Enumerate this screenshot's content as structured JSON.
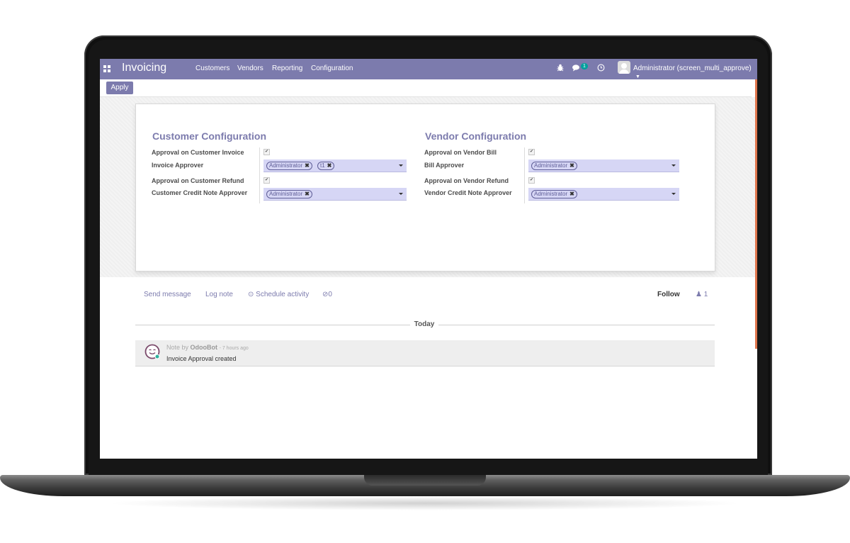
{
  "navbar": {
    "brand": "Invoicing",
    "menus": [
      "Customers",
      "Vendors",
      "Reporting",
      "Configuration"
    ],
    "messages_count": "1",
    "user": "Administrator (screen_multi_approve)",
    "icons": [
      "apps-icon",
      "bug-icon",
      "chat-icon",
      "clock-icon",
      "user-avatar",
      "caret-down-icon"
    ]
  },
  "control_panel": {
    "apply_label": "Apply"
  },
  "customer": {
    "title": "Customer Configuration",
    "approval_invoice_label": "Approval on Customer Invoice",
    "approval_invoice_checked": true,
    "invoice_approver_label": "Invoice Approver",
    "invoice_approvers": [
      "Administrator",
      "t1"
    ],
    "approval_refund_label": "Approval on Customer Refund",
    "approval_refund_checked": true,
    "credit_note_approver_label": "Customer Credit Note Approver",
    "credit_note_approvers": [
      "Administrator"
    ]
  },
  "vendor": {
    "title": "Vendor Configuration",
    "approval_bill_label": "Approval on Vendor Bill",
    "approval_bill_checked": true,
    "bill_approver_label": "Bill Approver",
    "bill_approvers": [
      "Administrator"
    ],
    "approval_refund_label": "Approval on Vendor Refund",
    "approval_refund_checked": true,
    "credit_note_approver_label": "Vendor Credit Note Approver",
    "credit_note_approvers": [
      "Administrator"
    ]
  },
  "chatter": {
    "send_message": "Send message",
    "log_note": "Log note",
    "schedule_activity": "Schedule activity",
    "attachments": "0",
    "follow": "Follow",
    "followers": "1",
    "date_separator": "Today",
    "message": {
      "prefix": "Note by",
      "author": "OdooBot",
      "time": "- 7 hours ago",
      "body": "Invoice Approval created"
    }
  },
  "colors": {
    "brand": "#7c7bad",
    "badge": "#00a09d",
    "field_bg": "#d6d6f5"
  }
}
